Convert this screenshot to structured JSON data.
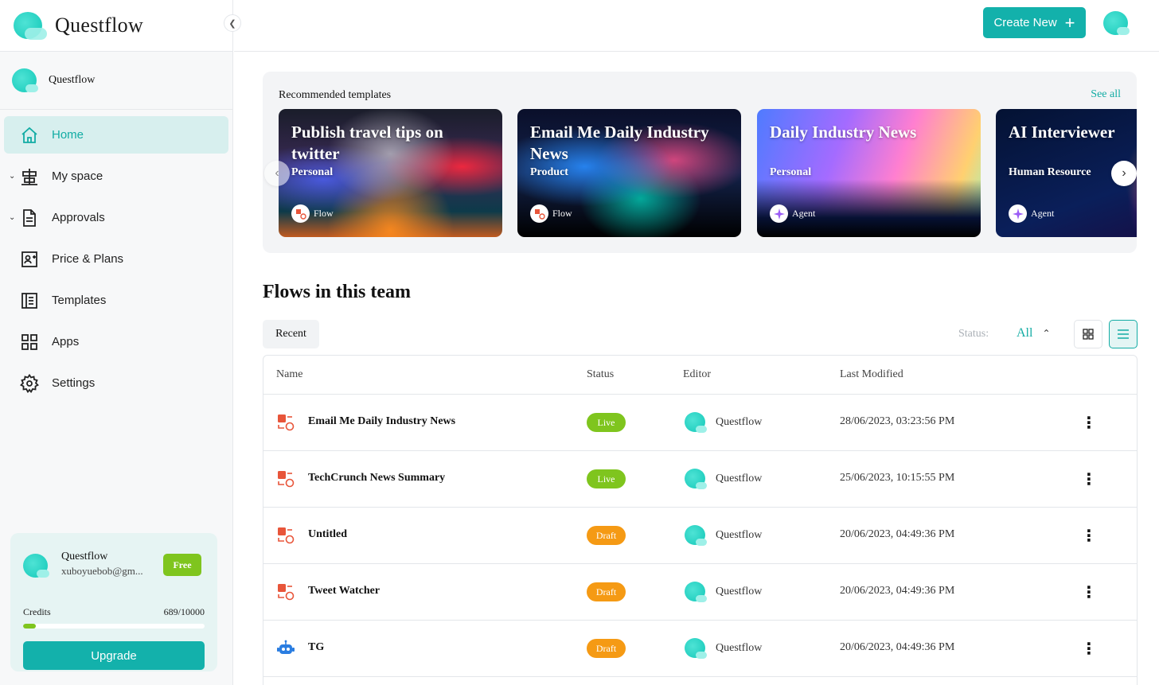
{
  "app": {
    "name": "Questflow"
  },
  "team": {
    "name": "Questflow"
  },
  "sidebar": {
    "items": [
      {
        "label": "Home",
        "icon": "home-icon",
        "active": true
      },
      {
        "label": "My space",
        "icon": "workspace-icon",
        "expandable": true
      },
      {
        "label": "Approvals",
        "icon": "document-icon",
        "expandable": true
      },
      {
        "label": "Price & Plans",
        "icon": "id-card-icon"
      },
      {
        "label": "Templates",
        "icon": "list-icon"
      },
      {
        "label": "Apps",
        "icon": "grid-icon"
      },
      {
        "label": "Settings",
        "icon": "gear-icon"
      }
    ]
  },
  "user": {
    "name": "Questflow",
    "email": "xuboyuebob@gm...",
    "plan": "Free",
    "credits_label": "Credits",
    "credits_text": "689/10000",
    "credits_fraction": 0.0689,
    "upgrade_label": "Upgrade"
  },
  "topbar": {
    "create_label": "Create New"
  },
  "recommended": {
    "title": "Recommended templates",
    "see_all": "See all",
    "cards": [
      {
        "title": "Publish travel tips on twitter",
        "category": "Personal",
        "type": "Flow"
      },
      {
        "title": "Email Me Daily Industry News",
        "category": "Product",
        "type": "Flow"
      },
      {
        "title": "Daily Industry News",
        "category": "Personal",
        "type": "Agent"
      },
      {
        "title": "AI Interviewer",
        "category": "Human Resource",
        "type": "Agent"
      }
    ]
  },
  "flows": {
    "title": "Flows in this team",
    "tab": "Recent",
    "status_label": "Status:",
    "status_value": "All",
    "columns": [
      "Name",
      "Status",
      "Editor",
      "Last Modified"
    ],
    "rows": [
      {
        "name": "Email Me Daily Industry News",
        "status": "Live",
        "editor": "Questflow",
        "modified": "28/06/2023, 03:23:56 PM",
        "icon": "flow-icon"
      },
      {
        "name": "TechCrunch News Summary",
        "status": "Live",
        "editor": "Questflow",
        "modified": "25/06/2023, 10:15:55 PM",
        "icon": "flow-icon"
      },
      {
        "name": "Untitled",
        "status": "Draft",
        "editor": "Questflow",
        "modified": "20/06/2023, 04:49:36 PM",
        "icon": "flow-icon"
      },
      {
        "name": "Tweet Watcher",
        "status": "Draft",
        "editor": "Questflow",
        "modified": "20/06/2023, 04:49:36 PM",
        "icon": "flow-icon"
      },
      {
        "name": "TG",
        "status": "Draft",
        "editor": "Questflow",
        "modified": "20/06/2023, 04:49:36 PM",
        "icon": "robot-icon"
      }
    ]
  },
  "colors": {
    "accent": "#13b1ab",
    "live": "#7fc51e",
    "draft": "#f59a14",
    "flow_icon": "#e8553a"
  }
}
